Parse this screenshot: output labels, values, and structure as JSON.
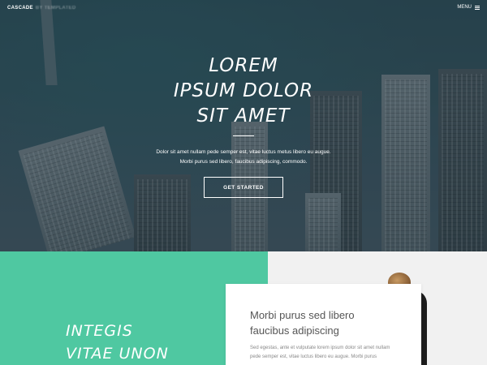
{
  "nav": {
    "brand": "CASCADE",
    "brand_sub": "BY TEMPLATED",
    "menu_label": "MENU",
    "menu_icon": "hamburger-icon"
  },
  "hero": {
    "headline": [
      "LOREM",
      "IPSUM DOLOR",
      "SIT AMET"
    ],
    "lead": [
      "Dolor sit amet nullam pede semper est, vitae luctus metus libero eu augue.",
      "Morbi purus sed libero, faucibus adipiscing, commodo."
    ],
    "cta_label": "GET STARTED"
  },
  "section": {
    "heading": [
      "INTEGIS",
      "VITAE UNON"
    ],
    "card": {
      "title": [
        "Morbi purus sed libero",
        "faucibus adipiscing"
      ],
      "text": [
        "Sed egestas, ante et vulputate lorem ipsum dolor sit amet nullam",
        "pede semper est, vitae luctus libero eu augue. Morbi purus"
      ]
    }
  },
  "colors": {
    "accent_green": "#4fc8a1",
    "hero_overlay": "#2b4a55"
  }
}
